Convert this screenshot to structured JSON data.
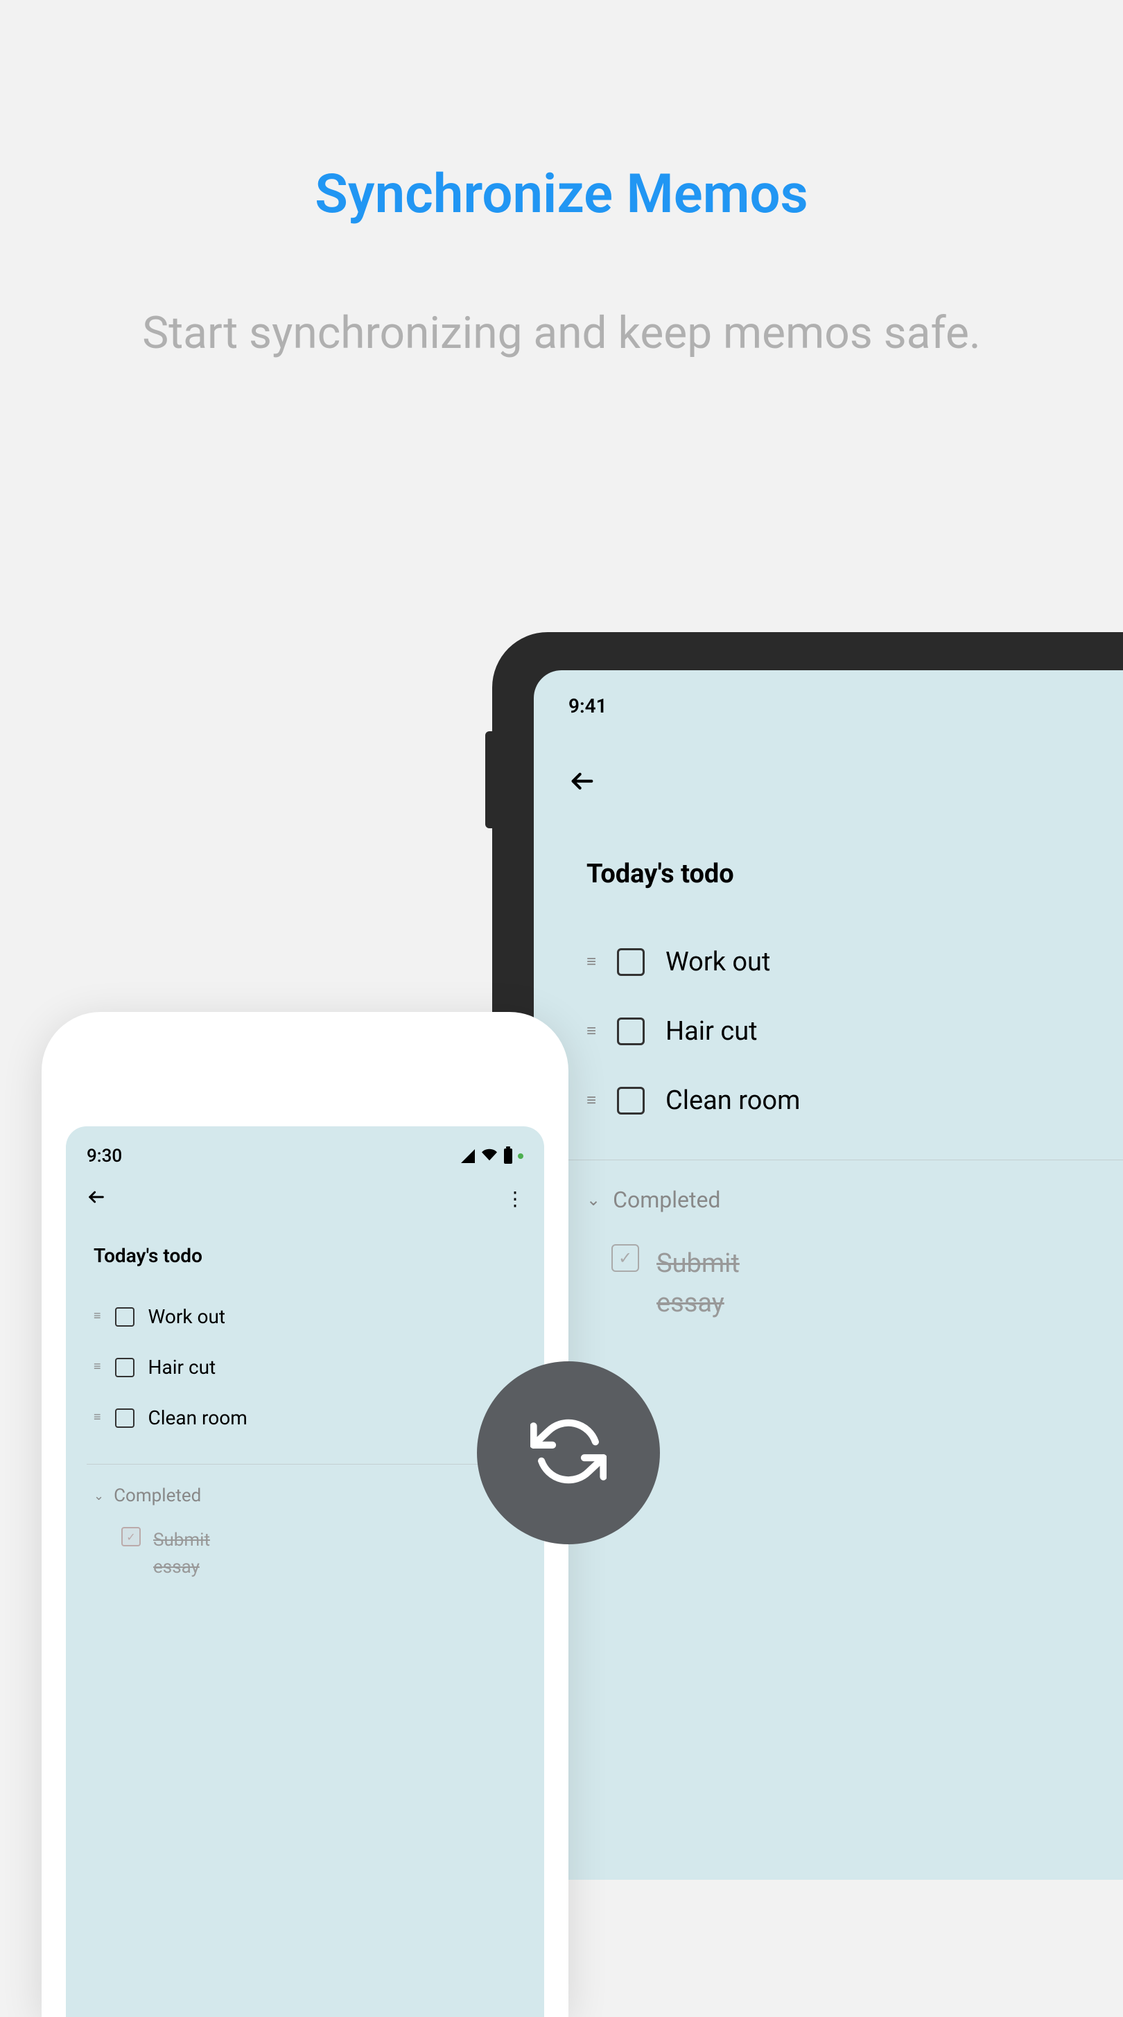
{
  "header": {
    "title": "Synchronize Memos",
    "subtitle": "Start synchronizing and keep memos safe."
  },
  "tablet": {
    "status_time": "9:41",
    "title": "Today's todo",
    "todos": [
      {
        "text": "Work out"
      },
      {
        "text": "Hair cut"
      },
      {
        "text": "Clean room"
      }
    ],
    "completed_label": "Completed",
    "completed_items": [
      {
        "text": "Submit essay"
      }
    ]
  },
  "phone": {
    "status_time": "9:30",
    "title": "Today's todo",
    "todos": [
      {
        "text": "Work out"
      },
      {
        "text": "Hair cut"
      },
      {
        "text": "Clean room"
      }
    ],
    "completed_label": "Completed",
    "completed_items": [
      {
        "text": "Submit essay"
      }
    ]
  }
}
